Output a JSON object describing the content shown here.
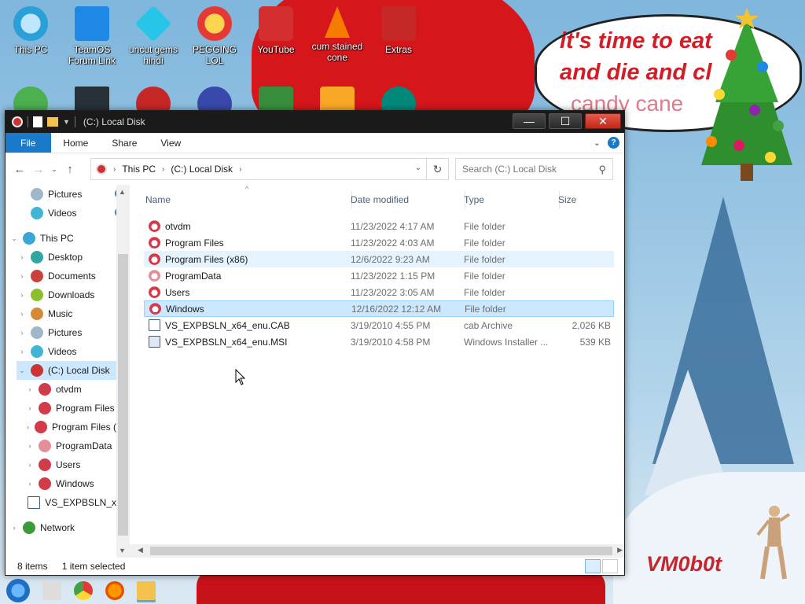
{
  "desktop": {
    "icons": [
      {
        "label": "This PC"
      },
      {
        "label": "TeamOS Forum Link"
      },
      {
        "label": "uncut gems hindi"
      },
      {
        "label": "PEGGING LOL"
      },
      {
        "label": "YouTube"
      },
      {
        "label": "cum stained cone"
      },
      {
        "label": "Extras"
      }
    ],
    "bubble_lines": [
      "it's time to eat",
      "and die and cl",
      "candy cane"
    ],
    "signature": "VM0b0t"
  },
  "window": {
    "title": "(C:) Local Disk",
    "buttons": {
      "minimize": "—",
      "maximize": "☐",
      "close": "✕"
    }
  },
  "ribbon": {
    "tabs": [
      "File",
      "Home",
      "Share",
      "View"
    ],
    "help": "?"
  },
  "address": {
    "crumbs": [
      "This PC",
      "(C:) Local Disk"
    ],
    "search_placeholder": "Search (C:) Local Disk"
  },
  "nav": {
    "items": [
      {
        "label": "Pictures"
      },
      {
        "label": "Videos"
      },
      {
        "label": "This PC"
      },
      {
        "label": "Desktop"
      },
      {
        "label": "Documents"
      },
      {
        "label": "Downloads"
      },
      {
        "label": "Music"
      },
      {
        "label": "Pictures"
      },
      {
        "label": "Videos"
      },
      {
        "label": "(C:) Local Disk"
      },
      {
        "label": "otvdm"
      },
      {
        "label": "Program Files"
      },
      {
        "label": "Program Files ("
      },
      {
        "label": "ProgramData"
      },
      {
        "label": "Users"
      },
      {
        "label": "Windows"
      },
      {
        "label": "VS_EXPBSLN_x"
      },
      {
        "label": "Network"
      }
    ]
  },
  "columns": {
    "name": "Name",
    "date": "Date modified",
    "type": "Type",
    "size": "Size"
  },
  "files": [
    {
      "name": "otvdm",
      "date": "11/23/2022 4:17 AM",
      "type": "File folder",
      "size": ""
    },
    {
      "name": "Program Files",
      "date": "11/23/2022 4:03 AM",
      "type": "File folder",
      "size": ""
    },
    {
      "name": "Program Files (x86)",
      "date": "12/6/2022 9:23 AM",
      "type": "File folder",
      "size": ""
    },
    {
      "name": "ProgramData",
      "date": "11/23/2022 1:15 PM",
      "type": "File folder",
      "size": ""
    },
    {
      "name": "Users",
      "date": "11/23/2022 3:05 AM",
      "type": "File folder",
      "size": ""
    },
    {
      "name": "Windows",
      "date": "12/16/2022 12:12 AM",
      "type": "File folder",
      "size": ""
    },
    {
      "name": "VS_EXPBSLN_x64_enu.CAB",
      "date": "3/19/2010 4:55 PM",
      "type": "cab Archive",
      "size": "2,026 KB"
    },
    {
      "name": "VS_EXPBSLN_x64_enu.MSI",
      "date": "3/19/2010 4:58 PM",
      "type": "Windows Installer ...",
      "size": "539 KB"
    }
  ],
  "status": {
    "count": "8 items",
    "selected": "1 item selected"
  },
  "colors": {
    "accent": "#1979ca",
    "selection": "#cce8ff",
    "hover": "#e5f3ff",
    "titlebar": "#1a1a1a"
  }
}
